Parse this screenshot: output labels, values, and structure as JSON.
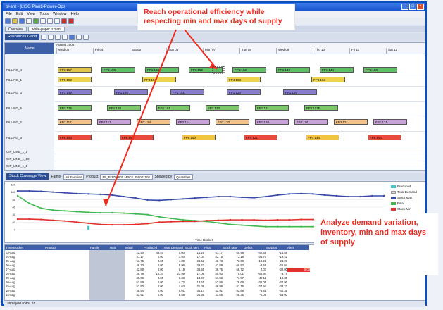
{
  "window": {
    "title": "pl-ant - [LISG Plant]-Power-Ops",
    "menu": [
      "File",
      "Edit",
      "View",
      "Tools",
      "Window",
      "Help"
    ]
  },
  "tabs": [
    "Overview",
    "white-paper.tr.plant"
  ],
  "gantt": {
    "view_label": "Resources Gantt",
    "resource_header": "Name",
    "month_label": "August 2006",
    "days": [
      "Wed 02",
      "Fri 04",
      "Sat 05",
      "Sun 06",
      "Mon 07",
      "Tue 08",
      "Wed 09",
      "Thu 10",
      "Fri 11",
      "Sat 12"
    ],
    "resources": [
      "FILLING_4",
      "FILLING_1",
      "FILLING_3",
      "FILLING_5",
      "FILLING_2",
      "FILLING_6",
      "CIP_LINE_1_1",
      "CIP_LINE_1_10",
      "CIP_LINE_1_1"
    ],
    "bars": [
      {
        "row": 0,
        "label": "FP1:157",
        "color": "#e3c44b"
      },
      {
        "row": 0,
        "label": "FP1:150",
        "color": "#5fbf63"
      },
      {
        "row": 0,
        "label": "FP1:150",
        "color": "#5fbf63"
      },
      {
        "row": 0,
        "label": "FP1:152",
        "color": "#5fbf63"
      },
      {
        "row": 0,
        "label": "FP1:152",
        "color": "#5fbf63"
      },
      {
        "row": 0,
        "label": "FP1:140",
        "color": "#5fbf63"
      },
      {
        "row": 0,
        "label": "FP1:144",
        "color": "#5fbf63"
      },
      {
        "row": 0,
        "label": "FP1:150",
        "color": "#5fbf63"
      },
      {
        "row": 1,
        "label": "FP5:152",
        "color": "#f0d34d"
      },
      {
        "row": 1,
        "label": "FP4:152",
        "color": "#f0d34d"
      },
      {
        "row": 1,
        "label": "FP4:153",
        "color": "#f0d34d"
      },
      {
        "row": 1,
        "label": "FP5:153",
        "color": "#f0d34d"
      },
      {
        "row": 2,
        "label": "FP1:149",
        "color": "#8a7ed0"
      },
      {
        "row": 2,
        "label": "FP1:150",
        "color": "#8a7ed0"
      },
      {
        "row": 2,
        "label": "FP1:151",
        "color": "#8a7ed0"
      },
      {
        "row": 2,
        "label": "FP1:120",
        "color": "#8a7ed0"
      },
      {
        "row": 2,
        "label": "FP1:125",
        "color": "#8a7ed0"
      },
      {
        "row": 3,
        "label": "FP1:135",
        "color": "#7cc86a"
      },
      {
        "row": 3,
        "label": "FP1:130",
        "color": "#7cc86a"
      },
      {
        "row": 3,
        "label": "FP1:151",
        "color": "#7cc86a"
      },
      {
        "row": 3,
        "label": "FP1:133",
        "color": "#7cc86a"
      },
      {
        "row": 3,
        "label": "FP1:131",
        "color": "#7cc86a"
      },
      {
        "row": 3,
        "label": "FP2:113F",
        "color": "#7cc86a"
      },
      {
        "row": 4,
        "label": "FP2:117",
        "color": "#f2c38c"
      },
      {
        "row": 4,
        "label": "FP2:117",
        "color": "#c7a3d8"
      },
      {
        "row": 4,
        "label": "FP2:124",
        "color": "#f2c38c"
      },
      {
        "row": 4,
        "label": "FP2:114",
        "color": "#c7a3d8"
      },
      {
        "row": 4,
        "label": "FP2:120",
        "color": "#f2c38c"
      },
      {
        "row": 4,
        "label": "FP1:120",
        "color": "#c7a3d8"
      },
      {
        "row": 4,
        "label": "FP2:105",
        "color": "#c7a3d8"
      },
      {
        "row": 4,
        "label": "FP2:121",
        "color": "#f2c38c"
      },
      {
        "row": 4,
        "label": "FP1:121",
        "color": "#c7a3d8"
      },
      {
        "row": 5,
        "label": "FP6:153",
        "color": "#e94a3a"
      },
      {
        "row": 5,
        "label": "FP6:152",
        "color": "#e94a3a"
      },
      {
        "row": 5,
        "label": "FP6:150",
        "color": "#f2c341"
      },
      {
        "row": 5,
        "label": "FP4:121",
        "color": "#e94a3a"
      },
      {
        "row": 5,
        "label": "FP4:144",
        "color": "#f2c341"
      },
      {
        "row": 5,
        "label": "FP6:144",
        "color": "#e94a3a"
      }
    ]
  },
  "callouts": {
    "top": "Reach operational efficiency while respecting min and max days of supply",
    "bottom": "Analyze demand variation, inventory, min and max days of supply"
  },
  "stock_view": {
    "view_label": "Stock Coverage View",
    "family_label": "Family",
    "family_value": "All Families",
    "product_label": "Product",
    "product_value": "FP_B 370x600 MPCK 25000x10K",
    "showed_label": "Showed by",
    "showed_value": "Quantities"
  },
  "chart_data": {
    "type": "line",
    "x_axis_label": "Time Bucket",
    "ylim": [
      0,
      120
    ],
    "yticks": [
      0,
      20,
      40,
      60,
      80,
      100,
      120
    ],
    "series": [
      {
        "name": "Produced",
        "type": "bar",
        "color": "#41c6c9",
        "values": [
          0,
          0,
          0,
          0,
          0,
          0,
          10,
          0,
          0,
          0,
          0,
          0,
          0,
          0,
          0,
          0,
          0,
          0,
          0,
          0,
          0,
          0,
          0,
          0,
          0,
          0,
          0,
          0,
          0,
          0,
          0,
          0
        ]
      },
      {
        "name": "Total Demand",
        "type": "bar",
        "color": "#d9d9d9",
        "values": [
          0,
          0,
          0,
          0,
          0,
          0,
          0,
          0,
          0,
          0,
          0,
          0,
          0,
          0,
          0,
          0,
          0,
          0,
          0,
          0,
          0,
          0,
          0,
          0,
          0,
          0,
          0,
          0,
          0,
          0,
          0,
          0
        ]
      },
      {
        "name": "Stock Max",
        "color": "#3848a8",
        "values": [
          103,
          103,
          102,
          100,
          98,
          96,
          95,
          94,
          92,
          88,
          84,
          79,
          78,
          80,
          82,
          84,
          86,
          88,
          88,
          86,
          85,
          88,
          92,
          95,
          96,
          95,
          92,
          90,
          88,
          88,
          90,
          90
        ]
      },
      {
        "name": "Final",
        "color": "#3fb84e",
        "values": [
          90,
          70,
          57,
          52,
          50,
          48,
          46,
          45,
          45,
          44,
          42,
          40,
          34,
          30,
          26,
          24,
          22,
          18,
          14,
          12,
          10,
          8,
          8,
          8,
          8,
          8,
          8,
          8,
          8,
          8,
          8,
          8
        ]
      },
      {
        "name": "Stock Min",
        "color": "#e0312b",
        "values": [
          28,
          28,
          27,
          25,
          23,
          20,
          17,
          14,
          13,
          13,
          14,
          16,
          20,
          21,
          22,
          22,
          24,
          25,
          26,
          26,
          26,
          25,
          26,
          26,
          27,
          27,
          25,
          24,
          22,
          22,
          23,
          24
        ]
      }
    ]
  },
  "table": {
    "columns": [
      "Time Bucket",
      "Product",
      "Family",
      "Unit",
      "Initial",
      "Produced",
      "Total Demand",
      "Stock Min",
      "Final",
      "Stock Max",
      "Deficit",
      "Surplus",
      "Alert"
    ],
    "rows": [
      [
        "03-Aug",
        "",
        "",
        "",
        "22.20",
        "43.57",
        "0.00",
        "14.25",
        "57.17",
        "60.99",
        "-42.65",
        "-13.85",
        ""
      ],
      [
        "04-Aug",
        "",
        "",
        "",
        "57.17",
        "0.00",
        "3.40",
        "17.04",
        "53.75",
        "73.18",
        "-36.70",
        "-19.42",
        ""
      ],
      [
        "05-Aug",
        "",
        "",
        "",
        "53.75",
        "0.00",
        "4.89",
        "38.52",
        "48.73",
        "73.00",
        "-10.21",
        "-24.28",
        ""
      ],
      [
        "06-Aug",
        "",
        "",
        "",
        "48.73",
        "0.00",
        "5.96",
        "39.23",
        "42.89",
        "68.92",
        "-3.58",
        "-26.04",
        ""
      ],
      [
        "07-Aug",
        "",
        "",
        "",
        "42.89",
        "0.00",
        "6.19",
        "38.55",
        "36.75",
        "68.72",
        "0.03",
        "-32.00",
        "0.03"
      ],
      [
        "08-Aug",
        "",
        "",
        "",
        "36.79",
        "10.37",
        "23.99",
        "17.06",
        "80.93",
        "75.01",
        "-66.94",
        "-5.75",
        ""
      ],
      [
        "09-Aug",
        "",
        "",
        "",
        "30.09",
        "0.00",
        "6.33",
        "13.97",
        "57.58",
        "71.97",
        "-42.11",
        "-13.85",
        ""
      ],
      [
        "10-Aug",
        "",
        "",
        "",
        "52.89",
        "0.00",
        "4.72",
        "13.61",
        "52.86",
        "76.66",
        "-36.05",
        "-24.90",
        ""
      ],
      [
        "15-Aug",
        "",
        "",
        "",
        "52.90",
        "0.00",
        "4.63",
        "21.08",
        "48.98",
        "81.16",
        "-27.94",
        "-32.22",
        ""
      ],
      [
        "18-Aug",
        "",
        "",
        "",
        "48.94",
        "0.00",
        "6.01",
        "30.17",
        "42.91",
        "82.88",
        "-8.81",
        "-40.35",
        ""
      ],
      [
        "14-Aug",
        "",
        "",
        "",
        "42.91",
        "0.00",
        "6.56",
        "30.56",
        "33.65",
        "85.35",
        "-0.09",
        "-53.00",
        ""
      ]
    ]
  },
  "status": "Displayed rows: 28"
}
